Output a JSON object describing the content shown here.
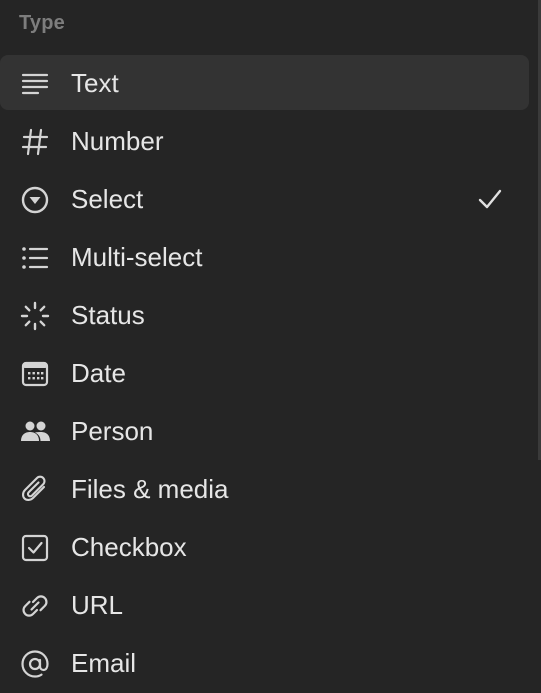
{
  "menu": {
    "header": "Type",
    "selected_index": 2,
    "hovered_index": 0,
    "items": [
      {
        "label": "Text",
        "icon": "text-lines-icon"
      },
      {
        "label": "Number",
        "icon": "hash-icon"
      },
      {
        "label": "Select",
        "icon": "select-circle-icon"
      },
      {
        "label": "Multi-select",
        "icon": "bulleted-list-icon"
      },
      {
        "label": "Status",
        "icon": "status-loader-icon"
      },
      {
        "label": "Date",
        "icon": "calendar-icon"
      },
      {
        "label": "Person",
        "icon": "people-icon"
      },
      {
        "label": "Files & media",
        "icon": "paperclip-icon"
      },
      {
        "label": "Checkbox",
        "icon": "checkbox-icon"
      },
      {
        "label": "URL",
        "icon": "link-icon"
      },
      {
        "label": "Email",
        "icon": "at-sign-icon"
      }
    ]
  },
  "colors": {
    "background": "#252525",
    "hover": "#333333",
    "text": "#e6e6e6",
    "header": "#7d7d7d"
  }
}
